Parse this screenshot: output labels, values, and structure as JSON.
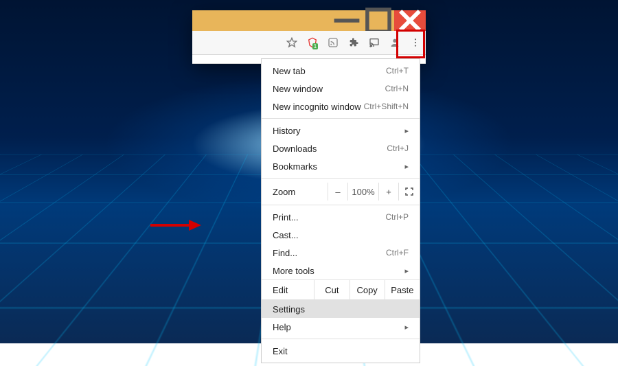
{
  "menu": {
    "new_tab": {
      "label": "New tab",
      "shortcut": "Ctrl+T"
    },
    "new_window": {
      "label": "New window",
      "shortcut": "Ctrl+N"
    },
    "new_incognito": {
      "label": "New incognito window",
      "shortcut": "Ctrl+Shift+N"
    },
    "history": {
      "label": "History"
    },
    "downloads": {
      "label": "Downloads",
      "shortcut": "Ctrl+J"
    },
    "bookmarks": {
      "label": "Bookmarks"
    },
    "zoom": {
      "label": "Zoom",
      "minus": "–",
      "value": "100%",
      "plus": "+"
    },
    "print": {
      "label": "Print...",
      "shortcut": "Ctrl+P"
    },
    "cast": {
      "label": "Cast..."
    },
    "find": {
      "label": "Find...",
      "shortcut": "Ctrl+F"
    },
    "more_tools": {
      "label": "More tools"
    },
    "edit": {
      "label": "Edit",
      "cut": "Cut",
      "copy": "Copy",
      "paste": "Paste"
    },
    "settings": {
      "label": "Settings"
    },
    "help": {
      "label": "Help"
    },
    "exit": {
      "label": "Exit"
    }
  }
}
